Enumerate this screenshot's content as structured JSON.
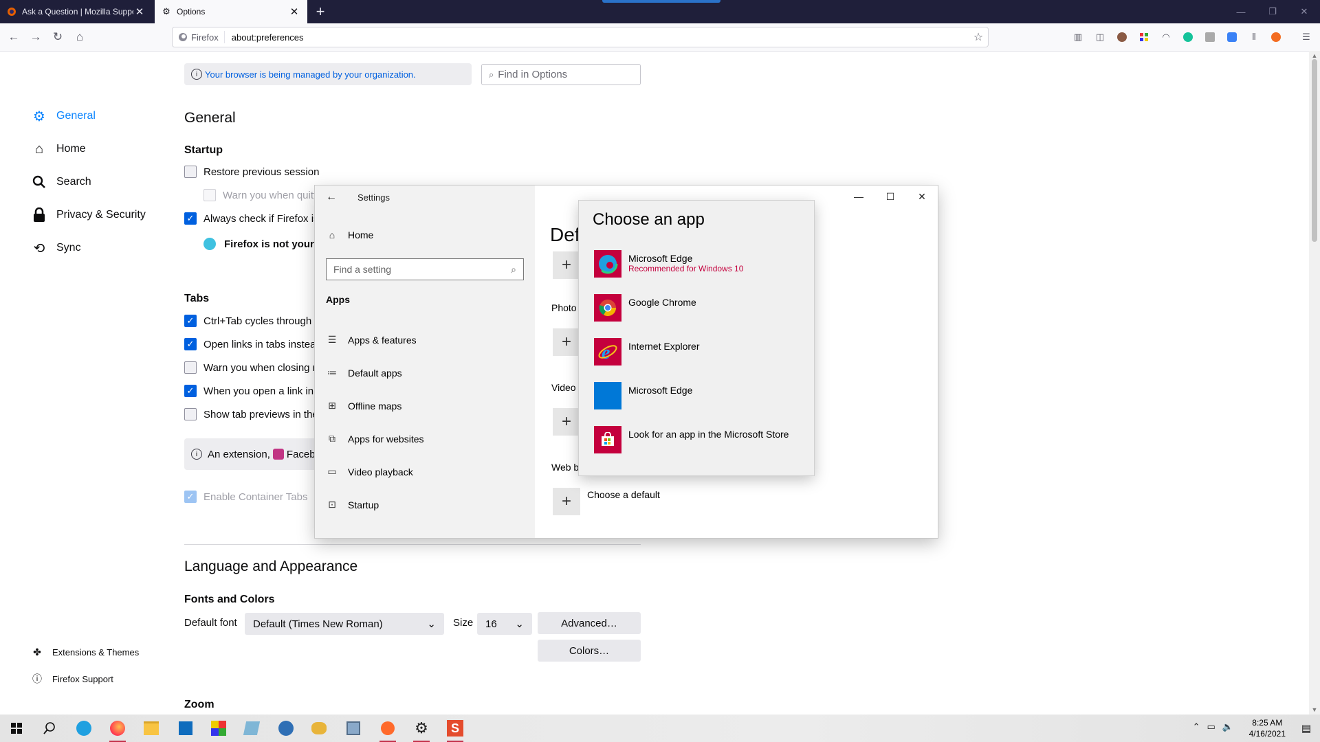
{
  "browser": {
    "tabs": [
      {
        "title": "Ask a Question | Mozilla Suppo",
        "active": false
      },
      {
        "title": "Options",
        "active": true
      }
    ],
    "new_tab": "+",
    "identity_label": "Firefox",
    "url": "about:preferences"
  },
  "prefs": {
    "managed_notice": "Your browser is being managed by your organization.",
    "find_placeholder": "Find in Options",
    "categories": [
      {
        "label": "General",
        "icon": "gear-icon",
        "selected": true
      },
      {
        "label": "Home",
        "icon": "home-icon"
      },
      {
        "label": "Search",
        "icon": "search-icon"
      },
      {
        "label": "Privacy & Security",
        "icon": "lock-icon"
      },
      {
        "label": "Sync",
        "icon": "sync-icon"
      }
    ],
    "footer": [
      {
        "label": "Extensions & Themes",
        "icon": "puzzle-icon"
      },
      {
        "label": "Firefox Support",
        "icon": "help-icon"
      }
    ],
    "general_heading": "General",
    "startup_heading": "Startup",
    "startup": [
      {
        "label": "Restore previous session",
        "checked": false
      },
      {
        "label": "Warn you when quitt",
        "checked": false,
        "disabled": true
      },
      {
        "label": "Always check if Firefox is",
        "checked": true
      }
    ],
    "default_status": "Firefox is not your c",
    "tabs_heading": "Tabs",
    "tabs": [
      {
        "label": "Ctrl+Tab cycles through t",
        "checked": true
      },
      {
        "label": "Open links in tabs instea",
        "checked": true
      },
      {
        "label": "Warn you when closing m",
        "checked": false
      },
      {
        "label": "When you open a link in",
        "checked": true
      },
      {
        "label": "Show tab previews in the",
        "checked": false
      }
    ],
    "extension_note_prefix": "An extension,",
    "extension_note_name": "Facebo",
    "container_tabs": {
      "label": "Enable Container Tabs",
      "checked": true,
      "link": "L"
    },
    "lang_heading": "Language and Appearance",
    "fonts_heading": "Fonts and Colors",
    "default_font_label": "Default font",
    "default_font_value": "Default (Times New Roman)",
    "size_label": "Size",
    "size_value": "16",
    "advanced_button": "Advanced…",
    "colors_button": "Colors…",
    "zoom_heading": "Zoom"
  },
  "settings_window": {
    "title": "Settings",
    "home": "Home",
    "search_placeholder": "Find a setting",
    "section": "Apps",
    "nav": [
      {
        "label": "Apps & features",
        "icon": "list-icon"
      },
      {
        "label": "Default apps",
        "icon": "default-apps-icon"
      },
      {
        "label": "Offline maps",
        "icon": "map-icon"
      },
      {
        "label": "Apps for websites",
        "icon": "website-icon"
      },
      {
        "label": "Video playback",
        "icon": "video-icon"
      },
      {
        "label": "Startup",
        "icon": "startup-icon"
      }
    ],
    "right_heading_partial": "Def",
    "photo_label": "Photo",
    "video_label": "Video",
    "web_label": "Web b",
    "choose_default": "Choose a default"
  },
  "chooser": {
    "title": "Choose an app",
    "apps": [
      {
        "name": "Microsoft Edge",
        "sub": "Recommended for Windows 10",
        "icon": "edge-icon"
      },
      {
        "name": "Google Chrome",
        "sub": "",
        "icon": "chrome-icon"
      },
      {
        "name": "Internet Explorer",
        "sub": "",
        "icon": "ie-icon"
      },
      {
        "name": "Microsoft Edge",
        "sub": "",
        "icon": "edge-legacy-icon"
      },
      {
        "name": "Look for an app in the Microsoft Store",
        "sub": "",
        "icon": "store-icon"
      }
    ]
  },
  "taskbar": {
    "time": "8:25 AM",
    "date": "4/16/2021"
  },
  "colors": {
    "accent": "#0a84ff",
    "checkbox": "#0060df",
    "tabbar": "#1f1f3a",
    "recommended": "#c4003d"
  }
}
